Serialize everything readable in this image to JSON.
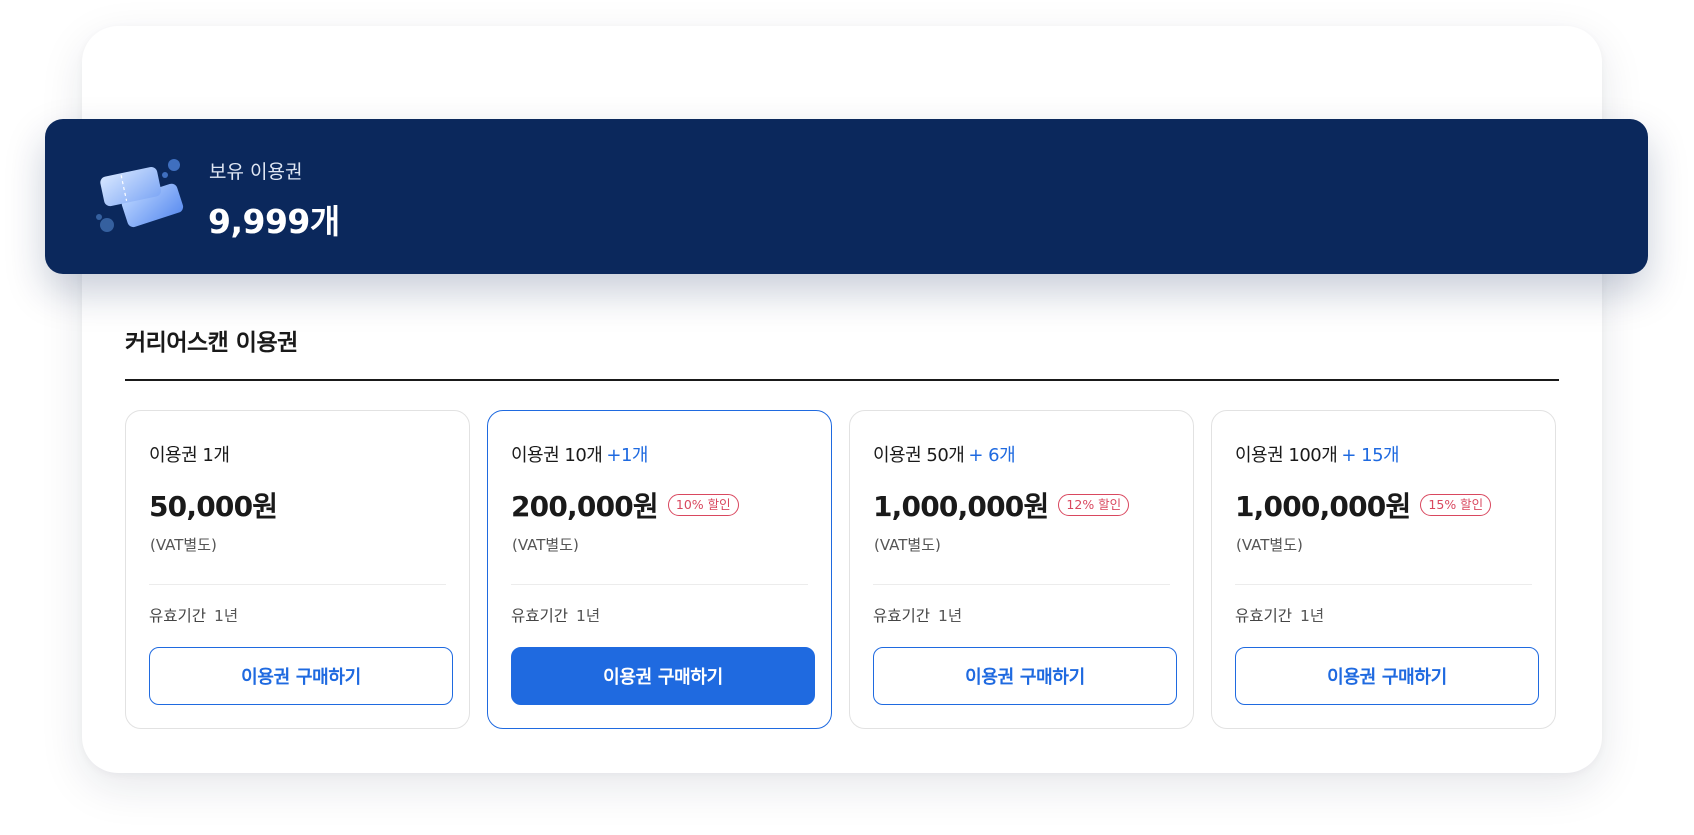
{
  "banner": {
    "label": "보유 이용권",
    "count": "9,999개",
    "icon": "ticket-icon"
  },
  "section": {
    "title": "커리어스캔 이용권"
  },
  "plans": [
    {
      "name": "이용권 1개",
      "bonus": "",
      "price": "50,000원",
      "discount": "",
      "vat": "(VAT별도)",
      "validity_label": "유효기간",
      "validity_value": "1년",
      "button": "이용권 구매하기",
      "featured": false
    },
    {
      "name": "이용권 10개",
      "bonus": "+1개",
      "price": "200,000원",
      "discount": "10% 할인",
      "vat": "(VAT별도)",
      "validity_label": "유효기간",
      "validity_value": "1년",
      "button": "이용권 구매하기",
      "featured": true
    },
    {
      "name": "이용권 50개",
      "bonus": "+ 6개",
      "price": "1,000,000원",
      "discount": "12% 할인",
      "vat": "(VAT별도)",
      "validity_label": "유효기간",
      "validity_value": "1년",
      "button": "이용권 구매하기",
      "featured": false
    },
    {
      "name": "이용권 100개",
      "bonus": "+ 15개",
      "price": "1,000,000원",
      "discount": "15% 할인",
      "vat": "(VAT별도)",
      "validity_label": "유효기간",
      "validity_value": "1년",
      "button": "이용권 구매하기",
      "featured": false
    }
  ],
  "colors": {
    "banner_bg": "#0b285c",
    "accent": "#1f6ae0",
    "discount": "#d9485f"
  }
}
